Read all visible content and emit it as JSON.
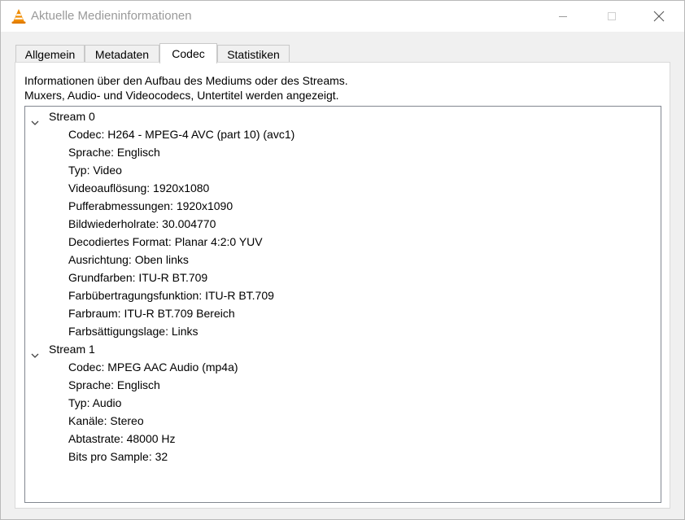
{
  "window": {
    "title": "Aktuelle Medieninformationen"
  },
  "icons": {
    "app": "vlc-cone-icon",
    "minimize": "minimize-icon",
    "maximize": "maximize-icon",
    "close": "close-icon",
    "expand": "chevron-down-icon"
  },
  "colors": {
    "cone_orange": "#f08c00",
    "cone_white": "#ffffff",
    "title_text": "#9a9a9a",
    "tree_border": "#828790"
  },
  "tabs": [
    {
      "label": "Allgemein",
      "selected": false
    },
    {
      "label": "Metadaten",
      "selected": false
    },
    {
      "label": "Codec",
      "selected": true
    },
    {
      "label": "Statistiken",
      "selected": false
    }
  ],
  "codec": {
    "info_line1": "Informationen über den Aufbau des Mediums oder des Streams.",
    "info_line2": "Muxers, Audio- und Videocodecs, Untertitel werden angezeigt.",
    "streams": [
      {
        "label": "Stream 0",
        "expanded": true,
        "items": [
          "Codec: H264 - MPEG-4 AVC (part 10) (avc1)",
          "Sprache: Englisch",
          "Typ: Video",
          "Videoauflösung: 1920x1080",
          "Pufferabmessungen: 1920x1090",
          "Bildwiederholrate: 30.004770",
          "Decodiertes Format: Planar 4:2:0 YUV",
          "Ausrichtung: Oben links",
          "Grundfarben: ITU-R BT.709",
          "Farbübertragungsfunktion: ITU-R BT.709",
          "Farbraum: ITU-R BT.709 Bereich",
          "Farbsättigungslage: Links"
        ]
      },
      {
        "label": "Stream 1",
        "expanded": true,
        "items": [
          "Codec: MPEG AAC Audio (mp4a)",
          "Sprache: Englisch",
          "Typ: Audio",
          "Kanäle: Stereo",
          "Abtastrate: 48000 Hz",
          "Bits pro Sample: 32"
        ]
      }
    ]
  }
}
